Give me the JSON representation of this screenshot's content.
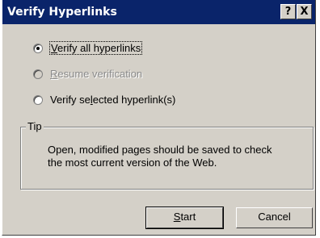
{
  "window": {
    "title": "Verify Hyperlinks",
    "help_glyph": "?",
    "close_glyph": "X"
  },
  "options": [
    {
      "label_pre": "",
      "label_key": "V",
      "label_post": "erify all hyperlinks",
      "checked": true,
      "disabled": false
    },
    {
      "label_pre": "",
      "label_key": "R",
      "label_post": "esume verification",
      "checked": false,
      "disabled": true
    },
    {
      "label_pre": "Verify se",
      "label_key": "l",
      "label_post": "ected hyperlink(s)",
      "checked": false,
      "disabled": false
    }
  ],
  "tip": {
    "label": "Tip",
    "line1": "Open, modified pages should be saved to check",
    "line2": "the most current version of the Web."
  },
  "buttons": {
    "start_key": "S",
    "start_rest": "tart",
    "cancel": "Cancel"
  }
}
